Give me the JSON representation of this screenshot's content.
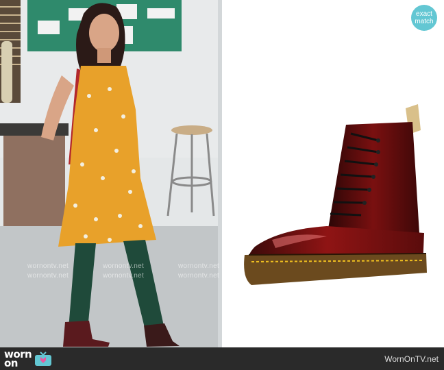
{
  "badge": {
    "line1": "exact",
    "line2": "match"
  },
  "footer": {
    "logo_top": "worn",
    "logo_bottom": "on",
    "site": "WornOnTV.net"
  },
  "watermark": "wornontv.net",
  "colors": {
    "badge": "#63c7d3",
    "footer_bg": "#2a2a2a",
    "dress": "#e8a12a",
    "boot": "#7a1212",
    "tights": "#1f4a3a"
  },
  "icons": [
    "tv-icon",
    "exact-match-badge"
  ]
}
